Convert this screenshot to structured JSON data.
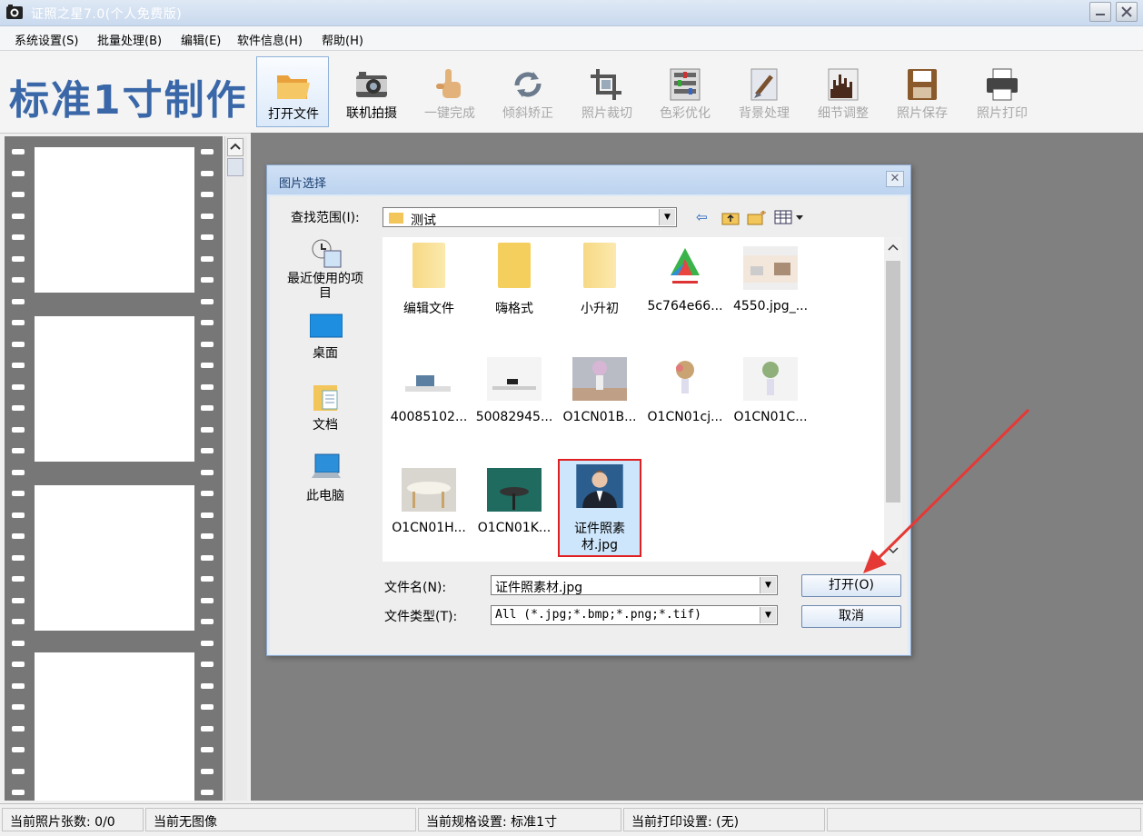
{
  "window": {
    "title": "证照之星7.0(个人免费版)"
  },
  "menu": [
    {
      "label": "系统设置(S)"
    },
    {
      "label": "批量处理(B)"
    },
    {
      "label": "编辑(E)"
    },
    {
      "label": "软件信息(H)"
    },
    {
      "label": "帮助(H)"
    }
  ],
  "toolbar": {
    "brand": "标准1寸制作",
    "buttons": [
      {
        "label": "打开文件",
        "icon": "open-folder-icon",
        "enabled": true,
        "active": true
      },
      {
        "label": "联机拍摄",
        "icon": "camera-icon",
        "enabled": true
      },
      {
        "label": "一键完成",
        "icon": "hand-pointer-icon",
        "enabled": false
      },
      {
        "label": "倾斜矫正",
        "icon": "rotate-icon",
        "enabled": false
      },
      {
        "label": "照片裁切",
        "icon": "crop-icon",
        "enabled": false
      },
      {
        "label": "色彩优化",
        "icon": "color-adjust-icon",
        "enabled": false
      },
      {
        "label": "背景处理",
        "icon": "brush-icon",
        "enabled": false
      },
      {
        "label": "细节调整",
        "icon": "histogram-icon",
        "enabled": false
      },
      {
        "label": "照片保存",
        "icon": "floppy-disk-icon",
        "enabled": false
      },
      {
        "label": "照片打印",
        "icon": "printer-icon",
        "enabled": false
      }
    ]
  },
  "dialog": {
    "title": "图片选择",
    "look_in_label": "查找范围(I):",
    "look_in_value": "测试",
    "places": [
      {
        "label": "最近使用的项目",
        "icon": "recent-items-icon"
      },
      {
        "label": "桌面",
        "icon": "desktop-icon"
      },
      {
        "label": "文档",
        "icon": "documents-icon"
      },
      {
        "label": "此电脑",
        "icon": "computer-icon"
      }
    ],
    "files": [
      {
        "name": "编辑文件",
        "type": "folder"
      },
      {
        "name": "嗨格式",
        "type": "folder"
      },
      {
        "name": "小升初",
        "type": "folder"
      },
      {
        "name": "5c764e66...",
        "type": "image"
      },
      {
        "name": "4550.jpg_...",
        "type": "image"
      },
      {
        "name": "40085102...",
        "type": "image"
      },
      {
        "name": "50082945...",
        "type": "image"
      },
      {
        "name": "O1CN01B...",
        "type": "image"
      },
      {
        "name": "O1CN01cj...",
        "type": "image"
      },
      {
        "name": "O1CN01C...",
        "type": "image"
      },
      {
        "name": "O1CN01H...",
        "type": "image"
      },
      {
        "name": "O1CN01K...",
        "type": "image"
      },
      {
        "name": "证件照素材.jpg",
        "type": "image",
        "selected": true
      }
    ],
    "filename_label": "文件名(N):",
    "filename_value": "证件照素材.jpg",
    "filetype_label": "文件类型(T):",
    "filetype_value": "All (*.jpg;*.bmp;*.png;*.tif)",
    "open_button": "打开(O)",
    "cancel_button": "取消"
  },
  "statusbar": {
    "count": "当前照片张数: 0/0",
    "image": "当前无图像",
    "spec": "当前规格设置: 标准1寸",
    "print": "当前打印设置: (无)"
  },
  "colors": {
    "brand": "#3a67a8",
    "highlight_border": "#e02020",
    "arrow": "#e53935"
  }
}
